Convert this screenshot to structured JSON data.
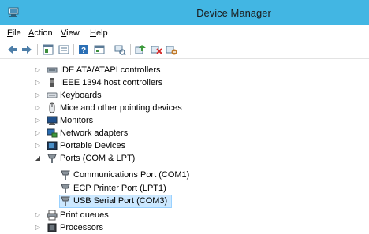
{
  "window": {
    "title": "Device Manager"
  },
  "menubar": {
    "items": [
      {
        "label": "File",
        "accel": "F",
        "rest": "ile"
      },
      {
        "label": "Action",
        "accel": "A",
        "rest": "ction"
      },
      {
        "label": "View",
        "accel": "V",
        "rest": "iew"
      },
      {
        "label": "Help",
        "accel": "H",
        "rest": "elp"
      }
    ]
  },
  "toolbar": {
    "buttons": [
      "back-icon",
      "forward-icon",
      "properties-icon",
      "show-hidden-icon",
      "help-icon",
      "console-tree-icon",
      "scan-hardware-icon",
      "update-driver-icon",
      "uninstall-icon",
      "disable-icon"
    ]
  },
  "tree": {
    "items": [
      {
        "label": "IDE ATA/ATAPI controllers",
        "expander": "collapsed",
        "icon": "ide-controller-icon"
      },
      {
        "label": "IEEE 1394 host controllers",
        "expander": "collapsed",
        "icon": "ieee1394-icon"
      },
      {
        "label": "Keyboards",
        "expander": "collapsed",
        "icon": "keyboard-icon"
      },
      {
        "label": "Mice and other pointing devices",
        "expander": "collapsed",
        "icon": "mouse-icon"
      },
      {
        "label": "Monitors",
        "expander": "collapsed",
        "icon": "monitor-icon"
      },
      {
        "label": "Network adapters",
        "expander": "collapsed",
        "icon": "network-adapter-icon"
      },
      {
        "label": "Portable Devices",
        "expander": "collapsed",
        "icon": "portable-device-icon"
      },
      {
        "label": "Ports (COM & LPT)",
        "expander": "expanded",
        "icon": "port-icon"
      },
      {
        "label": "Communications Port (COM1)",
        "expander": "none",
        "icon": "port-icon"
      },
      {
        "label": "ECP Printer Port (LPT1)",
        "expander": "none",
        "icon": "port-icon"
      },
      {
        "label": "USB Serial Port (COM3)",
        "expander": "none",
        "icon": "port-icon",
        "selected": true
      },
      {
        "label": "Print queues",
        "expander": "collapsed",
        "icon": "printer-icon"
      },
      {
        "label": "Processors",
        "expander": "collapsed",
        "icon": "processor-icon"
      }
    ]
  },
  "colors": {
    "titlebar": "#42b6e3",
    "selection": "#cce8ff",
    "selection_border": "#99d1ff"
  }
}
